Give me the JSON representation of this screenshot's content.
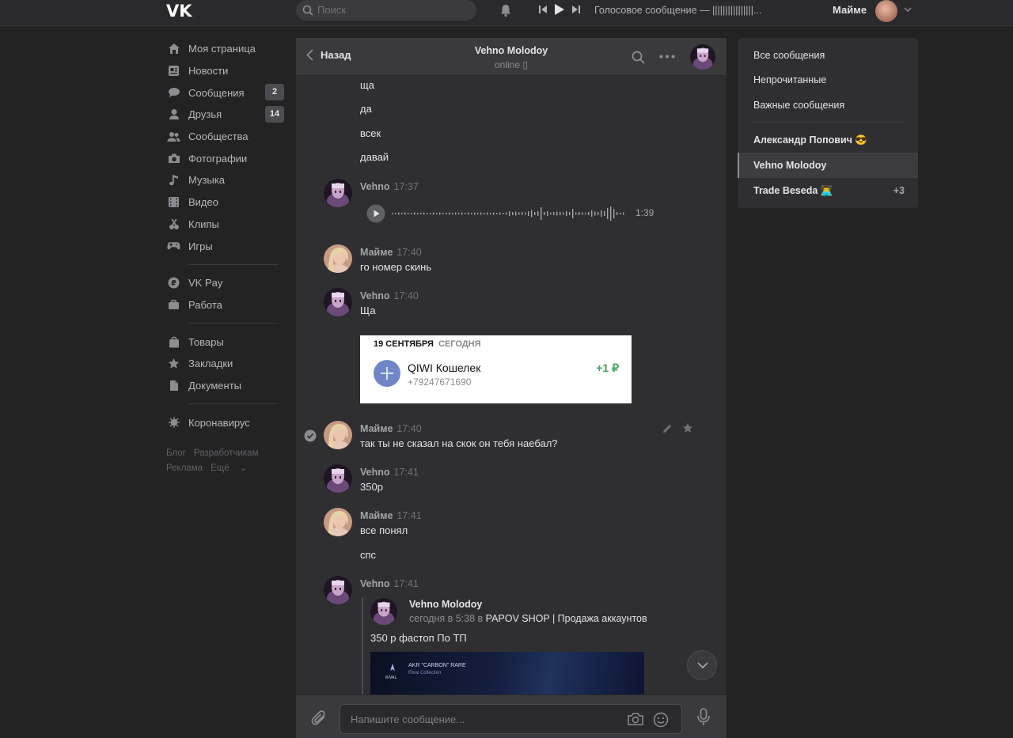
{
  "topbar": {
    "search_placeholder": "Поиск",
    "track_title": "Голосовое сообщение — ||||||||||||||||...",
    "user_name": "Майме"
  },
  "nav": {
    "items": [
      {
        "label": "Моя страница",
        "icon": "home-icon"
      },
      {
        "label": "Новости",
        "icon": "news-icon"
      },
      {
        "label": "Сообщения",
        "icon": "messages-icon",
        "badge": "2"
      },
      {
        "label": "Друзья",
        "icon": "friends-icon",
        "badge": "14"
      },
      {
        "label": "Сообщества",
        "icon": "communities-icon"
      },
      {
        "label": "Фотографии",
        "icon": "camera-icon"
      },
      {
        "label": "Музыка",
        "icon": "music-icon"
      },
      {
        "label": "Видео",
        "icon": "video-icon"
      },
      {
        "label": "Клипы",
        "icon": "clips-icon"
      },
      {
        "label": "Игры",
        "icon": "games-icon"
      }
    ],
    "group2": [
      {
        "label": "VK Pay",
        "icon": "vkpay-icon"
      },
      {
        "label": "Работа",
        "icon": "briefcase-icon"
      }
    ],
    "group3": [
      {
        "label": "Товары",
        "icon": "bag-icon"
      },
      {
        "label": "Закладки",
        "icon": "star-icon"
      },
      {
        "label": "Документы",
        "icon": "document-icon"
      }
    ],
    "group4": [
      {
        "label": "Коронавирус",
        "icon": "virus-icon"
      }
    ],
    "footer": [
      "Блог",
      "Разработчикам",
      "Реклама",
      "Ещё"
    ]
  },
  "chat": {
    "back_label": "Назад",
    "peer_name": "Vehno Molodoy",
    "peer_status": "online",
    "messages": {
      "t1": "ща",
      "t2": "да",
      "t3": "всек",
      "t4": "давай",
      "a1": "Vehno",
      "a1_time": "17:37",
      "voice_duration": "1:39",
      "a2": "Майме",
      "a2_time": "17:40",
      "t5": "го номер скинь",
      "a3": "Vehno",
      "a3_time": "17:40",
      "t6": "Ща",
      "a4": "Майме",
      "a4_time": "17:40",
      "t7": "так ты не сказал на скок он тебя наебал?",
      "a5": "Vehno",
      "a5_time": "17:41",
      "t8": "350р",
      "a6": "Майме",
      "a6_time": "17:41",
      "t9": "все понял",
      "t10": "спс",
      "a7": "Vehno",
      "a7_time": "17:41"
    },
    "qiwi": {
      "date": "19 СЕНТЯБРЯ",
      "today": "СЕГОДНЯ",
      "name": "QIWI Кошелек",
      "phone": "+79247671690",
      "amount": "+1 ₽"
    },
    "repost": {
      "author": "Vehno Molodoy",
      "meta_prefix": "сегодня в 5:38 в",
      "group": "PAPOV SHOP | Продажа аккаунтов",
      "text": "350 р фастоп По ТП",
      "image_item": "AKR \"CARBON\" RARE",
      "image_sub": "Rival Collection"
    },
    "composer_placeholder": "Напишите сообщение..."
  },
  "right": {
    "filters": [
      "Все сообщения",
      "Непрочитанные",
      "Важные сообщения"
    ],
    "dialogs": [
      {
        "name": "Александр Попович 😎"
      },
      {
        "name": "Vehno Molodoy"
      },
      {
        "name": "Trade Beseda 👨‍💻",
        "count": "+3"
      }
    ]
  }
}
